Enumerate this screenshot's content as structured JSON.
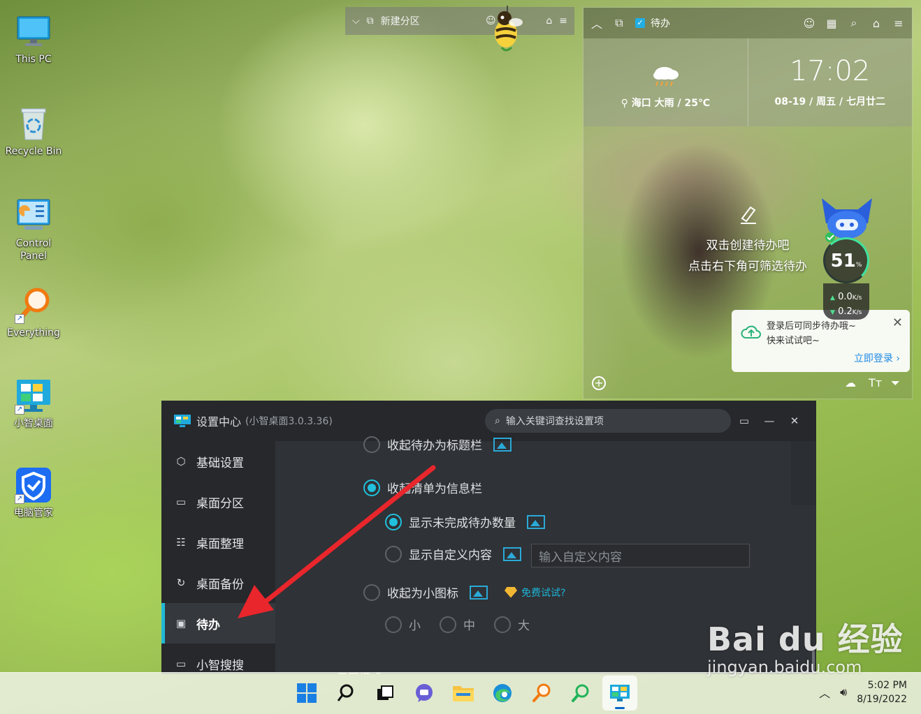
{
  "desktop": {
    "icons": [
      {
        "label": "This PC"
      },
      {
        "label": "Recycle Bin"
      },
      {
        "label": "Control Panel"
      },
      {
        "label": "Everything"
      },
      {
        "label": "小智桌面"
      },
      {
        "label": "电脑管家"
      }
    ]
  },
  "mini_bar": {
    "partition_label": "新建分区"
  },
  "todo_widget": {
    "title": "待办",
    "weather": {
      "location": "海口 大雨 / 25℃"
    },
    "clock": {
      "time": "17:02",
      "date": "08-19 / 周五 / 七月廿二"
    },
    "empty_line1": "双击创建待办吧",
    "empty_line2": "点击右下角可筛选待办",
    "login_popup": {
      "line1": "登录后可同步待办哦~",
      "line2": "快来试试吧~",
      "login_link": "立即登录 ›"
    }
  },
  "speed_ball": {
    "percent": "51",
    "percent_unit": "%",
    "upload": "0.0",
    "download": "0.2",
    "rate_unit": "K/s"
  },
  "settings": {
    "title": "设置中心",
    "version": "(小智桌面3.0.3.36)",
    "search_placeholder": "输入关键词查找设置项",
    "sidebar": [
      {
        "label": "基础设置",
        "icon": "hexagon-gear-icon"
      },
      {
        "label": "桌面分区",
        "icon": "monitor-icon"
      },
      {
        "label": "桌面整理",
        "icon": "grid-list-icon"
      },
      {
        "label": "桌面备份",
        "icon": "sync-icon"
      },
      {
        "label": "待办",
        "icon": "calendar-check-icon",
        "active": true
      },
      {
        "label": "小智搜搜",
        "icon": "window-icon"
      }
    ],
    "options": {
      "collapse_title_bar": "收起待办为标题栏",
      "collapse_info_bar": "收起清单为信息栏",
      "show_unfinished_count": "显示未完成待办数量",
      "show_custom_content": "显示自定义内容",
      "custom_content_placeholder": "输入自定义内容",
      "collapse_small_icon": "收起为小图标",
      "free_trial": "免费试试?",
      "size_small": "小",
      "size_medium": "中",
      "size_large": "大",
      "next_section_peek": "日历模式"
    }
  },
  "taskbar": {
    "time": "5:02 PM",
    "date": "8/19/2022"
  },
  "watermark": {
    "brand": "Bai du 经验",
    "url": "jingyan.baidu.com"
  },
  "colors": {
    "accent": "#21b9d6",
    "arrow": "#e8262c",
    "settings_bg": "#2f3236",
    "sidebar_bg": "#26282b"
  }
}
